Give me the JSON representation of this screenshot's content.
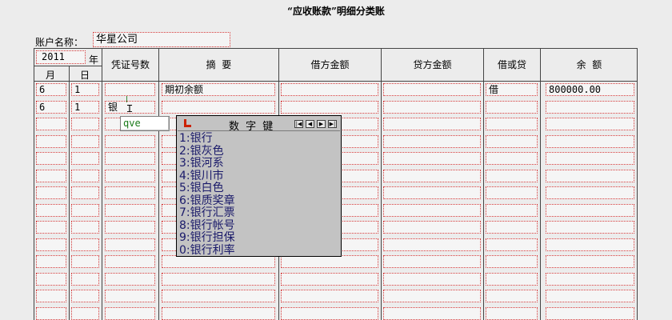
{
  "title": "“应收账款”明细分类账",
  "account": {
    "label": "账户名称：",
    "value": "华星公司"
  },
  "headers": {
    "year": "2011",
    "year_unit": "年",
    "month": "月",
    "day": "日",
    "voucher": "凭证号数",
    "summary": "摘  要",
    "debit": "借方金额",
    "credit": "贷方金额",
    "dr_cr": "借或贷",
    "balance": "余  额"
  },
  "rows": [
    {
      "month": "6",
      "day": "1",
      "voucher": "",
      "summary": "期初余额",
      "debit": "",
      "credit": "",
      "dr_cr": "借",
      "balance": "800000.00"
    },
    {
      "month": "6",
      "day": "1",
      "voucher": "银",
      "summary": "",
      "debit": "",
      "credit": "",
      "dr_cr": "",
      "balance": ""
    }
  ],
  "ime": {
    "input": "qve",
    "title": "数 字 键",
    "candidates": [
      "1:银行",
      "2:银灰色",
      "3:银河系",
      "4:银川市",
      "5:银白色",
      "6:银质奖章",
      "7:银行汇票",
      "8:银行帐号",
      "9:银行担保",
      "0:银行利率"
    ]
  },
  "colors": {
    "cell_border": "#d53a3a",
    "grid_line": "#444444",
    "ime_text": "#1a1a6a",
    "ime_input_text": "#1a7a1a",
    "ime_logo": "#cc2200"
  }
}
